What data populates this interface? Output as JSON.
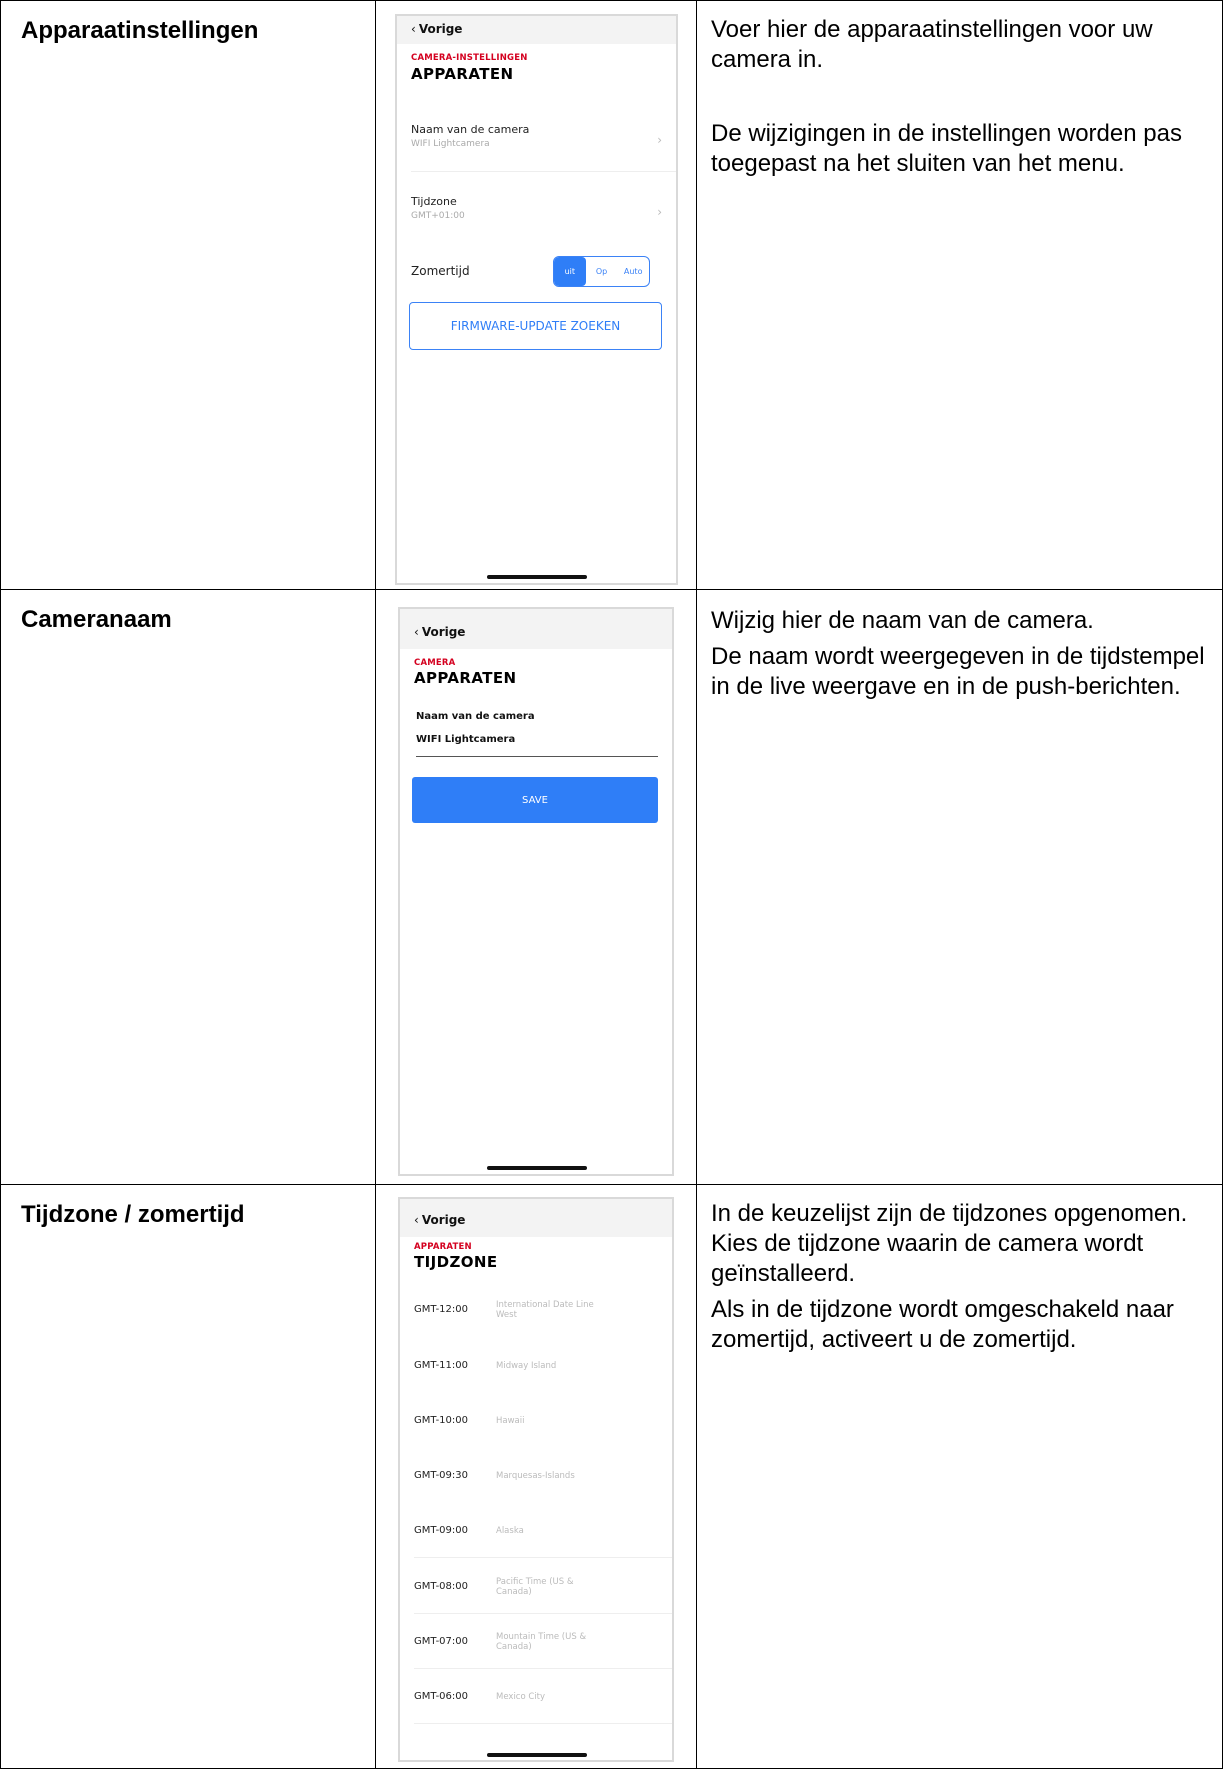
{
  "rows": [
    {
      "label": "Apparaatinstellingen",
      "description": [
        "Voer hier de apparaatinstellingen voor uw camera in.",
        "De wijzigingen in de instellingen worden pas toegepast na het sluiten van het menu."
      ],
      "phone": {
        "back": "Vorige",
        "kicker": "CAMERA-INSTELLINGEN",
        "title": "APPARATEN",
        "items": [
          {
            "title": "Naam van de camera",
            "value": "WIFI Lightcamera"
          },
          {
            "title": "Tijdzone",
            "value": "GMT+01:00"
          }
        ],
        "dst_label": "Zomertijd",
        "dst_options": [
          "uit",
          "Op",
          "Auto"
        ],
        "dst_selected": "uit",
        "firmware_button": "FIRMWARE-UPDATE ZOEKEN"
      }
    },
    {
      "label": "Cameranaam",
      "description": [
        "Wijzig hier de naam van de camera.",
        "De naam wordt weergegeven in de tijdstempel in de live weergave en in de push-berichten."
      ],
      "phone": {
        "back": "Vorige",
        "kicker": "CAMERA",
        "title": "APPARATEN",
        "field_label": "Naam van de camera",
        "field_value": "WIFI Lightcamera",
        "save_button": "SAVE"
      }
    },
    {
      "label": "Tijdzone / zomertijd",
      "description": [
        "In de keuzelijst zijn de tijdzones opgenomen. Kies de tijdzone waarin de camera wordt geïnstalleerd.",
        "Als in de tijdzone wordt omgeschakeld naar zomertijd, activeert u de zomertijd."
      ],
      "phone": {
        "back": "Vorige",
        "kicker": "APPARATEN",
        "title": "TIJDZONE",
        "timezones": [
          {
            "offset": "GMT-12:00",
            "name": "International Date Line West"
          },
          {
            "offset": "GMT-11:00",
            "name": "Midway Island"
          },
          {
            "offset": "GMT-10:00",
            "name": "Hawaii"
          },
          {
            "offset": "GMT-09:30",
            "name": "Marquesas-Islands"
          },
          {
            "offset": "GMT-09:00",
            "name": "Alaska"
          },
          {
            "offset": "GMT-08:00",
            "name": "Pacific Time (US & Canada)"
          },
          {
            "offset": "GMT-07:00",
            "name": "Mountain Time (US & Canada)"
          },
          {
            "offset": "GMT-06:00",
            "name": "Mexico City"
          }
        ]
      }
    }
  ]
}
